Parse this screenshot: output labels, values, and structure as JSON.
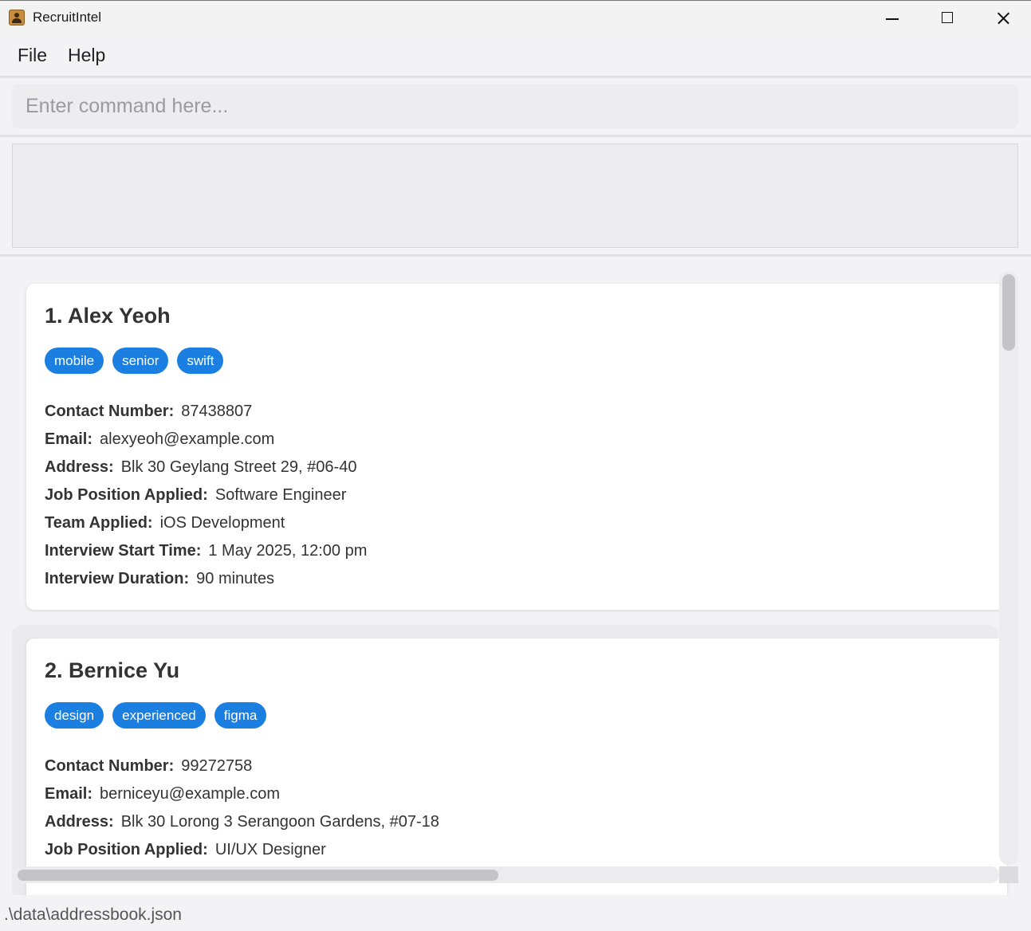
{
  "window": {
    "title": "RecruitIntel",
    "icon": "address-book-icon"
  },
  "menu": {
    "file": "File",
    "help": "Help"
  },
  "command": {
    "placeholder": "Enter command here...",
    "value": ""
  },
  "result": {
    "text": ""
  },
  "persons": [
    {
      "name": "1. Alex Yeoh",
      "tags": [
        "mobile",
        "senior",
        "swift"
      ],
      "fields": [
        {
          "label": "Contact Number:",
          "value": "87438807"
        },
        {
          "label": "Email:",
          "value": "alexyeoh@example.com"
        },
        {
          "label": "Address:",
          "value": "Blk 30 Geylang Street 29, #06-40"
        },
        {
          "label": "Job Position Applied:",
          "value": "Software Engineer"
        },
        {
          "label": "Team Applied:",
          "value": "iOS Development"
        },
        {
          "label": "Interview Start Time:",
          "value": "1 May 2025, 12:00 pm"
        },
        {
          "label": "Interview Duration:",
          "value": "90 minutes"
        }
      ]
    },
    {
      "name": "2. Bernice Yu",
      "tags": [
        "design",
        "experienced",
        "figma"
      ],
      "fields": [
        {
          "label": "Contact Number:",
          "value": "99272758"
        },
        {
          "label": "Email:",
          "value": "berniceyu@example.com"
        },
        {
          "label": "Address:",
          "value": "Blk 30 Lorong 3 Serangoon Gardens, #07-18"
        },
        {
          "label": "Job Position Applied:",
          "value": "UI/UX Designer"
        }
      ]
    }
  ],
  "status": {
    "file_path": ".\\data\\addressbook.json"
  },
  "colors": {
    "tag_background": "#1a7fe0",
    "card_background": "#ffffff",
    "app_background": "#f3f3f5"
  }
}
